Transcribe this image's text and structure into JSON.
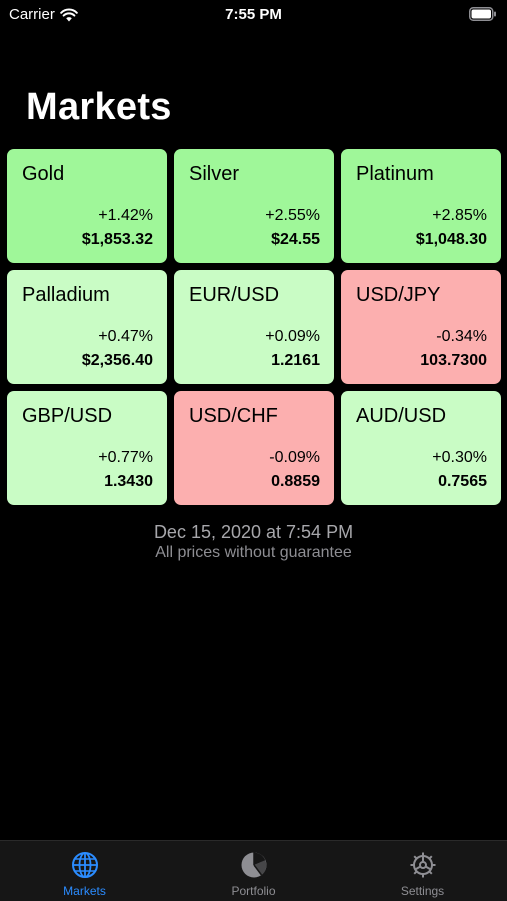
{
  "status_bar": {
    "carrier": "Carrier",
    "time": "7:55 PM"
  },
  "page_title": "Markets",
  "tiles": [
    {
      "name": "Gold",
      "change": "+1.42%",
      "price": "$1,853.32",
      "trend": "up-strong"
    },
    {
      "name": "Silver",
      "change": "+2.55%",
      "price": "$24.55",
      "trend": "up-strong"
    },
    {
      "name": "Platinum",
      "change": "+2.85%",
      "price": "$1,048.30",
      "trend": "up-strong"
    },
    {
      "name": "Palladium",
      "change": "+0.47%",
      "price": "$2,356.40",
      "trend": "up"
    },
    {
      "name": "EUR/USD",
      "change": "+0.09%",
      "price": "1.2161",
      "trend": "up"
    },
    {
      "name": "USD/JPY",
      "change": "-0.34%",
      "price": "103.7300",
      "trend": "down"
    },
    {
      "name": "GBP/USD",
      "change": "+0.77%",
      "price": "1.3430",
      "trend": "up"
    },
    {
      "name": "USD/CHF",
      "change": "-0.09%",
      "price": "0.8859",
      "trend": "down"
    },
    {
      "name": "AUD/USD",
      "change": "+0.30%",
      "price": "0.7565",
      "trend": "up"
    }
  ],
  "footer": {
    "timestamp": "Dec 15, 2020 at 7:54 PM",
    "disclaimer": "All prices without guarantee"
  },
  "tab_bar": {
    "tabs": [
      {
        "label": "Markets",
        "icon": "globe-icon",
        "active": true
      },
      {
        "label": "Portfolio",
        "icon": "pie-chart-icon",
        "active": false
      },
      {
        "label": "Settings",
        "icon": "gear-icon",
        "active": false
      }
    ]
  },
  "colors": {
    "background": "#000000",
    "tile_up_strong": "#9ff799",
    "tile_up": "#c9fcc5",
    "tile_down": "#fcafaf",
    "tab_active": "#2b8cff",
    "tab_inactive": "#8e8e93"
  }
}
